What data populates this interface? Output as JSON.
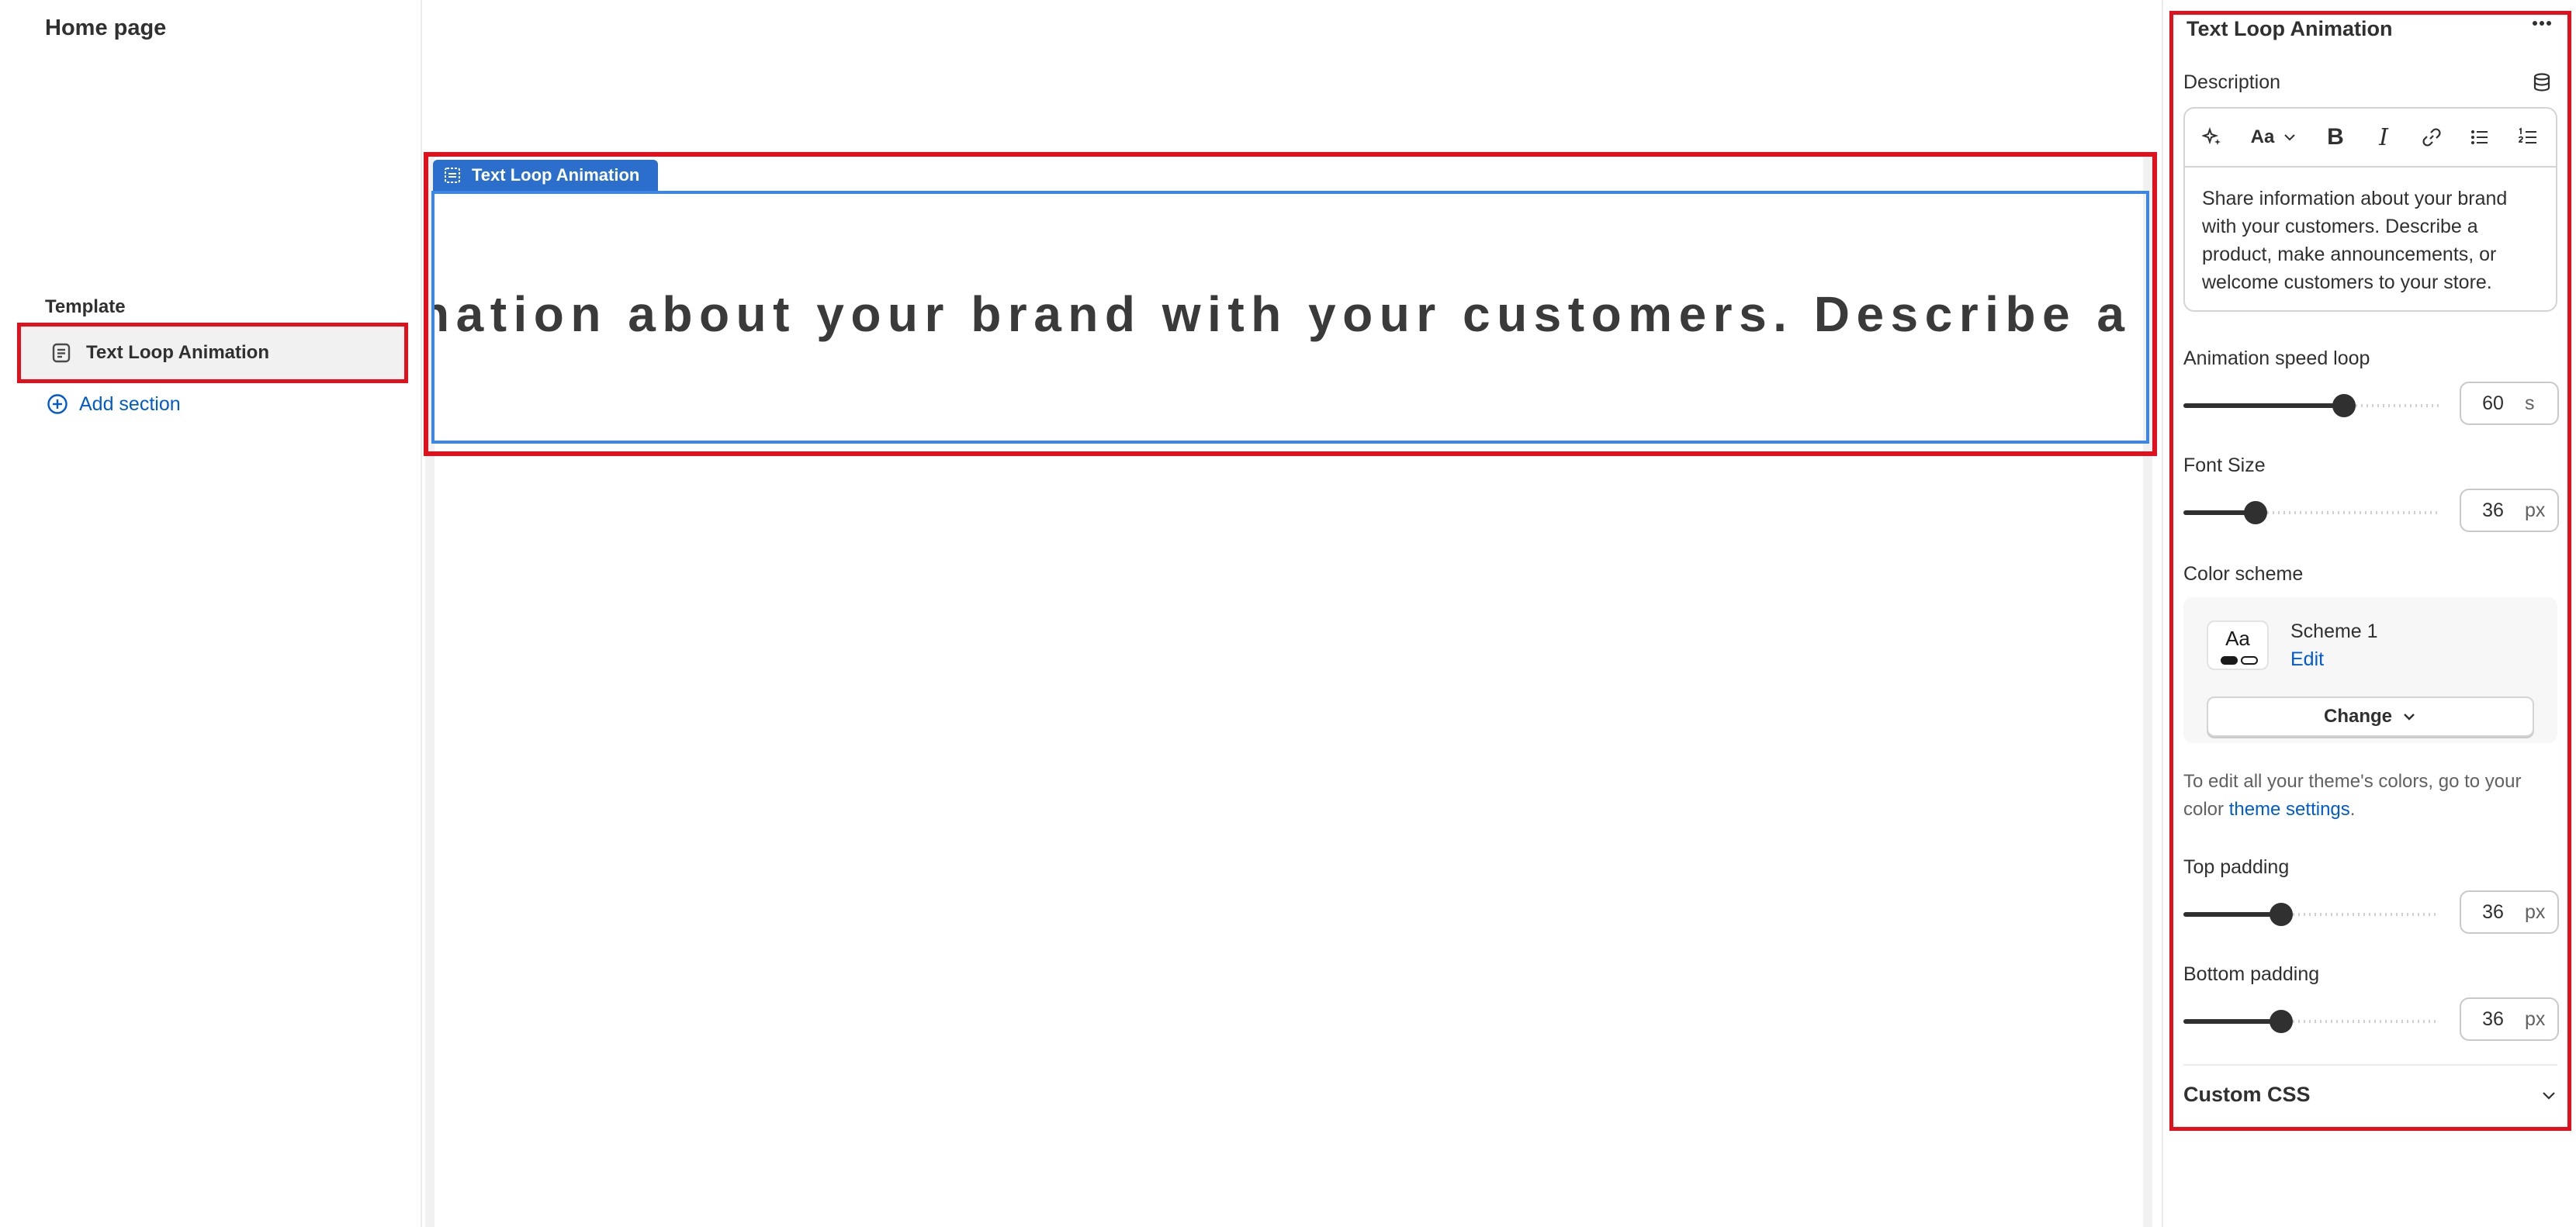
{
  "sidebar": {
    "page_title": "Home page",
    "template_label": "Template",
    "section_item": "Text Loop Animation",
    "add_section": "Add section"
  },
  "preview": {
    "section_tag": "Text Loop Animation",
    "marquee_text": "nation about your brand with your customers. Describe a produ"
  },
  "settings": {
    "title": "Text Loop Animation",
    "description_label": "Description",
    "toolbar": {
      "font_label": "Aa",
      "bold": "B",
      "italic": "I"
    },
    "description_text": "Share information about your brand with your customers. Describe a product, make announcements, or welcome customers to your store.",
    "animation_speed": {
      "label": "Animation speed loop",
      "value": "60",
      "unit": "s",
      "fill_fraction": 0.64
    },
    "font_size": {
      "label": "Font Size",
      "value": "36",
      "unit": "px",
      "fill_fraction": 0.26
    },
    "color_scheme": {
      "label": "Color scheme",
      "swatch_text": "Aa",
      "name": "Scheme 1",
      "edit": "Edit",
      "change": "Change"
    },
    "help_text_before": "To edit all your theme's colors, go to your color ",
    "help_link": "theme settings",
    "help_text_after": ".",
    "top_padding": {
      "label": "Top padding",
      "value": "36",
      "unit": "px",
      "fill_fraction": 0.37
    },
    "bottom_padding": {
      "label": "Bottom padding",
      "value": "36",
      "unit": "px",
      "fill_fraction": 0.37
    },
    "custom_css": "Custom CSS"
  },
  "colors": {
    "accent_blue": "#2c6ecb",
    "link_blue": "#005bd3",
    "highlight_red": "#e0101c"
  }
}
